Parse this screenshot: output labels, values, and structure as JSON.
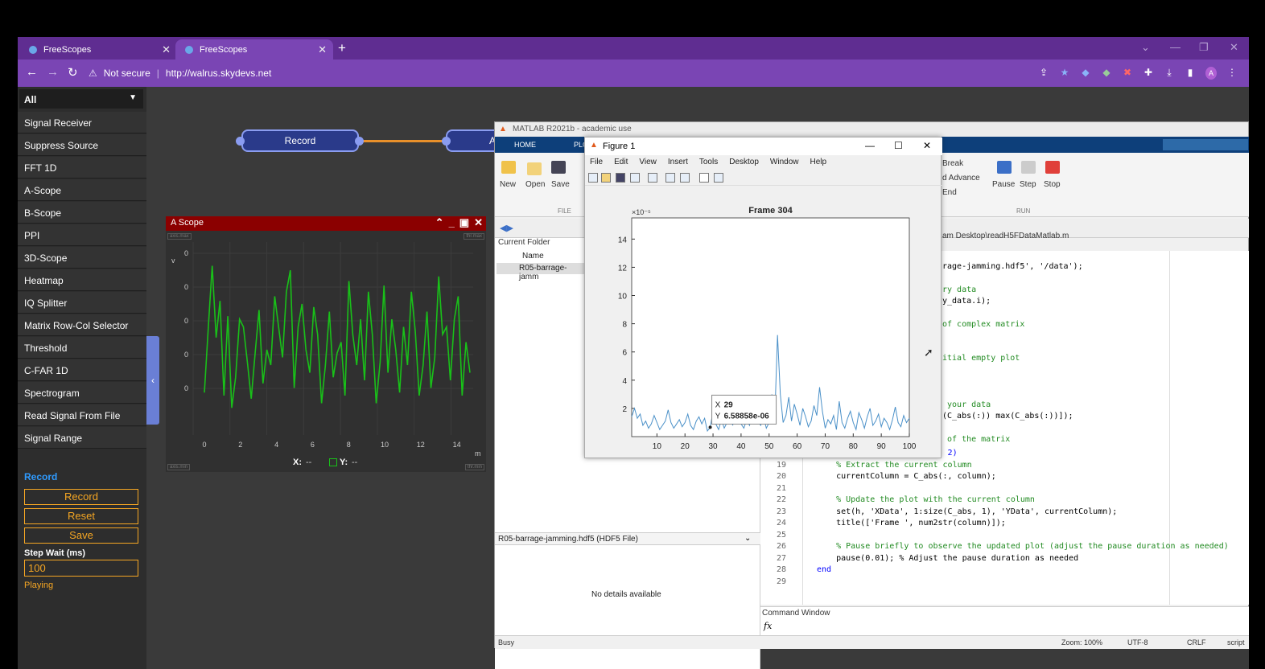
{
  "browser": {
    "tabs": [
      {
        "title": "FreeScopes",
        "active": false
      },
      {
        "title": "FreeScopes",
        "active": true
      }
    ],
    "security": "Not secure",
    "url": "http://walrus.skydevs.net",
    "profile_initial": "A",
    "accent_color": "#7a45b4"
  },
  "sidebar": {
    "filter": "All",
    "items": [
      "Signal Receiver",
      "Suppress Source",
      "FFT 1D",
      "A-Scope",
      "B-Scope",
      "PPI",
      "3D-Scope",
      "Heatmap",
      "IQ Splitter",
      "Matrix Row-Col Selector",
      "Threshold",
      "C-FAR 1D",
      "Spectrogram",
      "Read Signal From File",
      "Signal Range"
    ],
    "record_title": "Record",
    "buttons": {
      "record": "Record",
      "reset": "Reset",
      "save": "Save"
    },
    "step_wait_label": "Step Wait (ms)",
    "step_wait_value": "100",
    "state": "Playing"
  },
  "canvas": {
    "nodes": [
      "Record",
      "A"
    ]
  },
  "ascope": {
    "title": "A Scope",
    "axis_max": "axis.max",
    "axis_min": "axis.min",
    "time_max": "thr.max",
    "time_min": "thr.min",
    "v_label": "v",
    "y_ticks": [
      "0",
      "0",
      "0",
      "0",
      "0"
    ],
    "x_ticks": [
      "0",
      "2",
      "4",
      "6",
      "8",
      "10",
      "12",
      "14"
    ],
    "x_unit": "m",
    "readout_x_label": "X:",
    "readout_x": "--",
    "readout_y_label": "Y:",
    "readout_y": "--",
    "line_color": "#19c019",
    "values": [
      0.12,
      0.55,
      0.95,
      0.48,
      0.72,
      0.1,
      0.62,
      0.02,
      0.22,
      0.6,
      0.55,
      0.32,
      0.08,
      0.38,
      0.66,
      0.18,
      0.4,
      0.3,
      0.75,
      0.55,
      0.35,
      0.78,
      0.92,
      0.15,
      0.55,
      0.7,
      0.4,
      0.25,
      0.68,
      0.5,
      0.05,
      0.3,
      0.65,
      0.22,
      0.38,
      0.45,
      0.1,
      0.85,
      0.5,
      0.3,
      0.6,
      0.2,
      0.78,
      0.5,
      0.05,
      0.32,
      0.82,
      0.25,
      0.6,
      0.4,
      0.12,
      0.55,
      0.3,
      0.78,
      0.52,
      0.1,
      0.3,
      0.65,
      0.15,
      0.35,
      0.88,
      0.5,
      0.55,
      0.2,
      0.6,
      0.75,
      0.1,
      0.45,
      0.25
    ]
  },
  "matlab": {
    "title": "MATLAB R2021b - academic use",
    "tabs": [
      "HOME",
      "PLO"
    ],
    "file_buttons": [
      "New",
      "Open",
      "Save"
    ],
    "file_section": "FILE",
    "run_items": [
      "Break",
      "d Advance",
      "End"
    ],
    "run_buttons": [
      "Pause",
      "Step",
      "Stop"
    ],
    "run_section": "RUN",
    "current_folder_label": "Current Folder",
    "name_col": "Name",
    "file_row": "R05-barrage-jamm",
    "path": "am Desktop\\readH5FDataMatlab.m",
    "details_file": "R05-barrage-jamming.hdf5  (HDF5 File)",
    "details_text": "No details available",
    "command_window": "Command Window",
    "fx": "fx",
    "status_left": "Busy",
    "zoom": "Zoom: 100%",
    "encoding": "UTF-8",
    "eol": "CRLF",
    "type": "script",
    "code_top": [
      {
        "text": "rage-jamming.hdf5', '/data');",
        "color": "#000"
      },
      {
        "text": "",
        "color": "#000"
      },
      {
        "text": "ry data",
        "color": "#228b22"
      },
      {
        "text": "y_data.i);",
        "color": "#000"
      },
      {
        "text": "",
        "color": "#000"
      },
      {
        "text": "of complex matrix",
        "color": "#228b22"
      },
      {
        "text": "",
        "color": "#000"
      },
      {
        "text": "",
        "color": "#000"
      },
      {
        "text": "itial empty plot",
        "color": "#228b22"
      },
      {
        "text": "",
        "color": "#000"
      },
      {
        "text": "",
        "color": "#000"
      },
      {
        "text": "",
        "color": "#000"
      },
      {
        "text": " your data",
        "color": "#228b22"
      },
      {
        "text": "(C_abs(:)) max(C_abs(:))]);",
        "color": "#000"
      },
      {
        "text": "",
        "color": "#000"
      },
      {
        "text": " of the matrix",
        "color": "#228b22"
      }
    ],
    "code_lines": [
      {
        "n": "18",
        "text": "for column = 1:size(C_abs, 2)"
      },
      {
        "n": "19",
        "text": "    % Extract the current column"
      },
      {
        "n": "20",
        "text": "    currentColumn = C_abs(:, column);"
      },
      {
        "n": "21",
        "text": ""
      },
      {
        "n": "22",
        "text": "    % Update the plot with the current column"
      },
      {
        "n": "23",
        "text": "    set(h, 'XData', 1:size(C_abs, 1), 'YData', currentColumn);"
      },
      {
        "n": "24",
        "text": "    title(['Frame ', num2str(column)]);"
      },
      {
        "n": "25",
        "text": ""
      },
      {
        "n": "26",
        "text": "    % Pause briefly to observe the updated plot (adjust the pause duration as needed)"
      },
      {
        "n": "27",
        "text": "    pause(0.01); % Adjust the pause duration as needed"
      },
      {
        "n": "28",
        "text": "end"
      },
      {
        "n": "29",
        "text": ""
      }
    ]
  },
  "figure": {
    "window_title": "Figure 1",
    "menus": [
      "File",
      "Edit",
      "View",
      "Insert",
      "Tools",
      "Desktop",
      "Window",
      "Help"
    ],
    "datatip_x_label": "X",
    "datatip_x": "29",
    "datatip_y_label": "Y",
    "datatip_y": "6.58858e-06"
  },
  "chart_data": {
    "type": "line",
    "title": "Frame 304",
    "xlabel": "",
    "ylabel": "",
    "y_exponent": "×10⁻⁵",
    "xlim": [
      1,
      100
    ],
    "ylim": [
      0,
      15.5
    ],
    "x_ticks": [
      10,
      20,
      30,
      40,
      50,
      60,
      70,
      80,
      90,
      100
    ],
    "y_ticks": [
      2,
      4,
      6,
      8,
      10,
      12,
      14
    ],
    "line_color": "#4a90c8",
    "y": [
      1.4,
      2.0,
      1.3,
      1.6,
      0.8,
      1.1,
      0.6,
      0.9,
      1.5,
      1.0,
      0.5,
      0.8,
      1.1,
      1.9,
      1.0,
      0.6,
      0.9,
      1.2,
      0.7,
      1.0,
      1.6,
      0.8,
      0.5,
      1.1,
      1.4,
      0.9,
      1.3,
      0.4,
      0.66,
      1.8,
      0.9,
      0.5,
      1.2,
      0.6,
      1.0,
      1.7,
      0.8,
      1.5,
      2.3,
      0.9,
      0.6,
      1.2,
      0.8,
      1.6,
      2.6,
      1.1,
      0.8,
      1.4,
      0.6,
      1.0,
      3.0,
      1.2,
      7.2,
      3.0,
      1.0,
      1.5,
      2.8,
      1.1,
      2.3,
      1.6,
      0.8,
      2.0,
      1.4,
      0.7,
      1.1,
      2.2,
      1.5,
      3.5,
      1.8,
      0.6,
      1.2,
      0.9,
      1.5,
      0.5,
      2.5,
      1.0,
      0.6,
      1.3,
      1.8,
      1.0,
      0.5,
      1.7,
      1.2,
      0.6,
      1.4,
      2.0,
      0.8,
      1.1,
      1.6,
      0.7,
      1.3,
      1.0,
      0.5,
      1.2,
      2.1,
      1.0,
      0.7,
      1.5,
      1.0,
      1.3
    ]
  }
}
